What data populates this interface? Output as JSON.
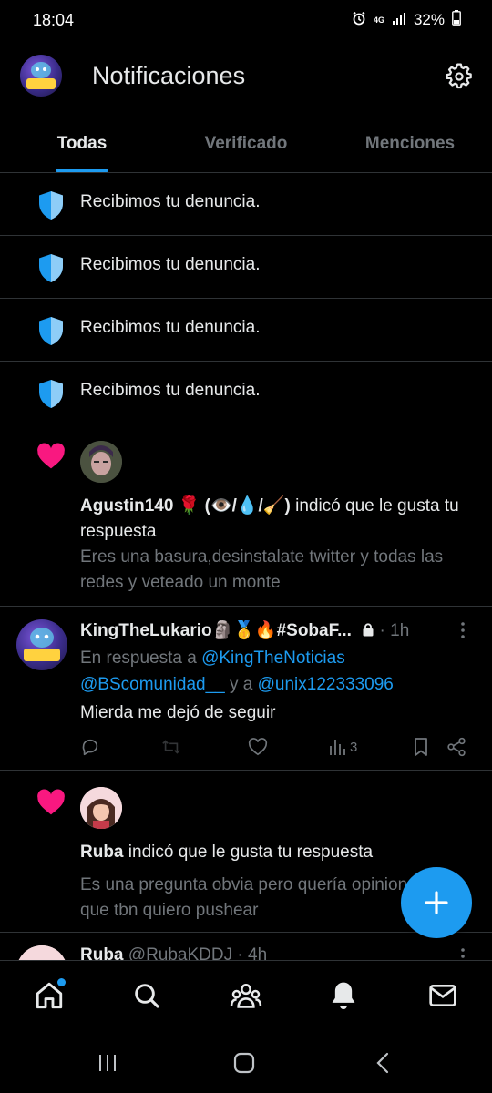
{
  "status_bar": {
    "time": "18:04",
    "network": "4G",
    "battery": "32%"
  },
  "header": {
    "title": "Notificaciones"
  },
  "tabs": [
    {
      "label": "Todas",
      "active": true
    },
    {
      "label": "Verificado",
      "active": false
    },
    {
      "label": "Menciones",
      "active": false
    }
  ],
  "reports": [
    {
      "text": "Recibimos tu denuncia."
    },
    {
      "text": "Recibimos tu denuncia."
    },
    {
      "text": "Recibimos tu denuncia."
    },
    {
      "text": "Recibimos tu denuncia."
    }
  ],
  "like_1": {
    "user": "Agustin140 🌹 (👁️/💧/🧹)",
    "action": " indicó que le gusta tu respuesta",
    "quote": "Eres una basura,desinstalate twitter y todas las redes y veteado un monte"
  },
  "tweet": {
    "name": "KingTheLukario🗿🥇🔥#SobaF...",
    "time": "1h",
    "reply_prefix": "En respuesta a ",
    "mention_1": "@KingTheNoticias",
    "mention_2": "@BScomunidad__",
    "reply_join": " y a ",
    "mention_3": "@unix122333096",
    "body": "Mierda me dejó de seguir",
    "views": "3"
  },
  "like_2": {
    "user": "Ruba",
    "action": " indicó que le gusta tu respuesta",
    "quote": "Es una pregunta obvia pero quería opiniones,ya que tbn quiero pushear"
  },
  "tweet_partial": {
    "name": "Ruba",
    "handle": "@RubaKDDJ",
    "time": "4h"
  },
  "colors": {
    "accent": "#1d9bf0",
    "like": "#f91880",
    "background": "#000000",
    "muted": "#71767b"
  }
}
